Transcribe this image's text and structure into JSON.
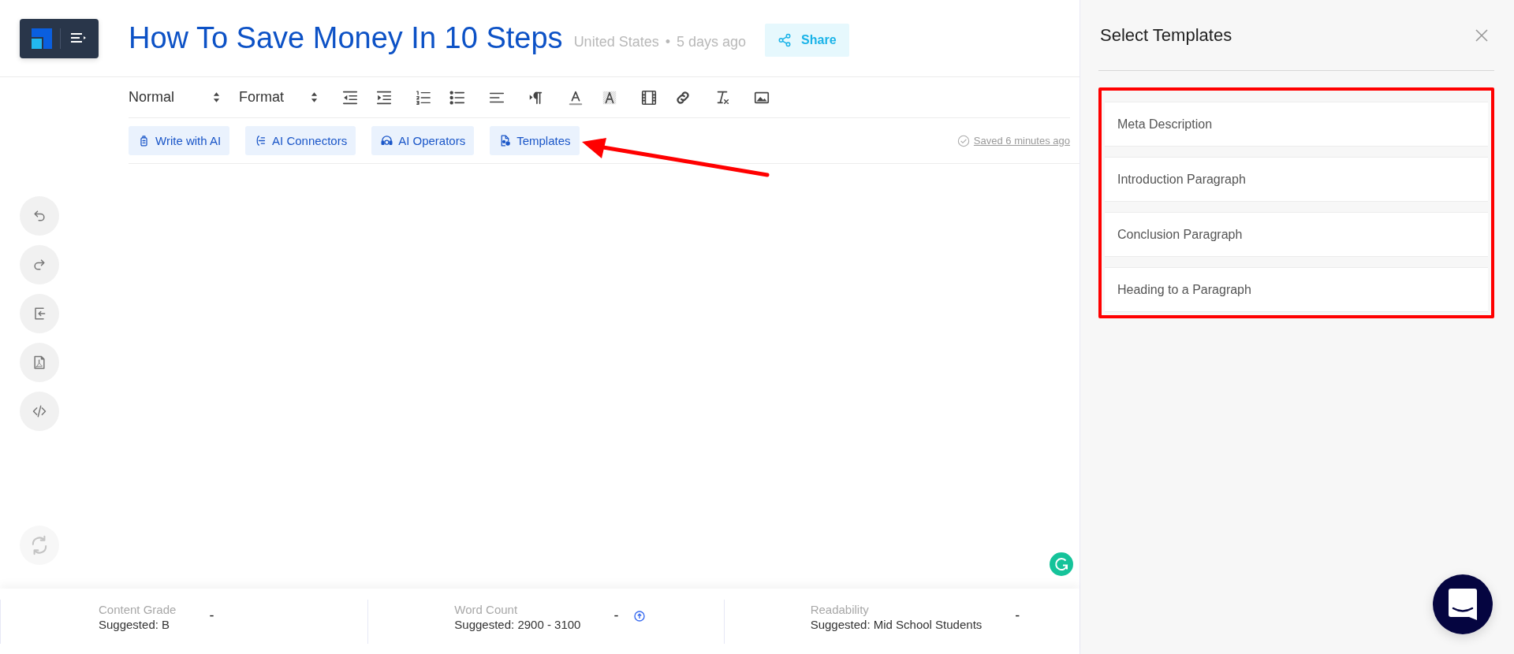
{
  "document": {
    "title": "How To Save Money In 10 Steps",
    "location": "United States",
    "separator": "•",
    "age": "5 days ago"
  },
  "share_button": {
    "label": "Share"
  },
  "toolbar": {
    "selects": [
      {
        "label": "Normal"
      },
      {
        "label": "Format"
      }
    ],
    "tools": [
      {
        "kind": "outdent"
      },
      {
        "kind": "indent"
      },
      {
        "kind": "ordered-list"
      },
      {
        "kind": "bullet-list"
      },
      {
        "kind": "align"
      },
      {
        "kind": "direction"
      },
      {
        "kind": "text-color"
      },
      {
        "kind": "highlight-color"
      },
      {
        "kind": "video"
      },
      {
        "kind": "link"
      },
      {
        "kind": "clear-format"
      },
      {
        "kind": "image"
      }
    ]
  },
  "ai_buttons": [
    {
      "kind": "write",
      "label": "Write with AI"
    },
    {
      "kind": "connectors",
      "label": "AI Connectors"
    },
    {
      "kind": "operators",
      "label": "AI Operators"
    },
    {
      "kind": "templates",
      "label": "Templates"
    }
  ],
  "save_status": "Saved 6 minutes ago",
  "side_actions": [
    {
      "kind": "undo",
      "disabled": false
    },
    {
      "kind": "redo",
      "disabled": false
    },
    {
      "kind": "import",
      "disabled": false
    },
    {
      "kind": "pdf",
      "disabled": false
    },
    {
      "kind": "code",
      "disabled": false
    },
    {
      "kind": "refresh",
      "disabled": true
    }
  ],
  "metrics": [
    {
      "label": "Content Grade",
      "suggestion": "Suggested: B",
      "value": "-",
      "info": false
    },
    {
      "label": "Word Count",
      "suggestion": "Suggested: 2900 - 3100",
      "value": "-",
      "info": true
    },
    {
      "label": "Readability",
      "suggestion": "Suggested: Mid School Students",
      "value": "-",
      "info": false
    }
  ],
  "panel": {
    "title": "Select Templates",
    "highlighted": true,
    "templates": [
      {
        "label": "Meta Description"
      },
      {
        "label": "Introduction Paragraph"
      },
      {
        "label": "Conclusion Paragraph"
      },
      {
        "label": "Heading to a Paragraph"
      }
    ]
  },
  "annotations": [
    {
      "kind": "arrow"
    }
  ]
}
